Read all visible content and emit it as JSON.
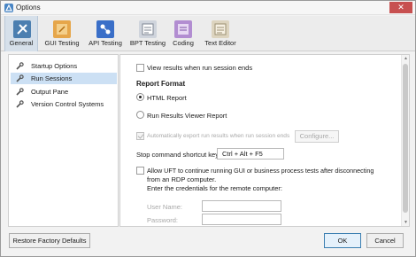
{
  "window": {
    "title": "Options",
    "close_glyph": "✕"
  },
  "toolbar": {
    "items": [
      {
        "label": "General",
        "icon": "general-settings-icon",
        "active": true
      },
      {
        "label": "GUI Testing",
        "icon": "gui-testing-icon"
      },
      {
        "label": "API Testing",
        "icon": "api-testing-icon"
      },
      {
        "label": "BPT Testing",
        "icon": "bpt-testing-icon"
      },
      {
        "label": "Coding",
        "icon": "coding-icon"
      },
      {
        "label": "Text Editor",
        "icon": "text-editor-icon"
      }
    ]
  },
  "sidebar": {
    "items": [
      {
        "label": "Startup Options",
        "icon": "wrench-icon"
      },
      {
        "label": "Run Sessions",
        "icon": "wrench-icon",
        "selected": true
      },
      {
        "label": "Output Pane",
        "icon": "wrench-icon"
      },
      {
        "label": "Version Control Systems",
        "icon": "wrench-icon"
      }
    ]
  },
  "content": {
    "view_results_label": "View results when run session ends",
    "report_format_heading": "Report Format",
    "html_report_label": "HTML Report",
    "run_results_viewer_label": "Run Results Viewer Report",
    "auto_export_label": "Automatically export run results when run session ends",
    "configure_button": "Configure...",
    "shortcut_label": "Stop command shortcut key:",
    "shortcut_value": "Ctrl + Alt + F5",
    "allow_uft_line1": "Allow UFT to continue running GUI or business process tests after disconnecting",
    "allow_uft_line2": "from an RDP computer.",
    "credentials_line": "Enter the credentials for the remote computer:",
    "user_name_label": "User Name:",
    "user_name_value": "",
    "password_label": "Password:",
    "password_value": ""
  },
  "footer": {
    "restore_button": "Restore Factory Defaults",
    "ok_button": "OK",
    "cancel_button": "Cancel"
  },
  "colors": {
    "selected_sidebar": "#cce0f4",
    "active_tab": "#d6e0ea",
    "close_button": "#c75050",
    "primary_button_border": "#3c7fb1"
  }
}
